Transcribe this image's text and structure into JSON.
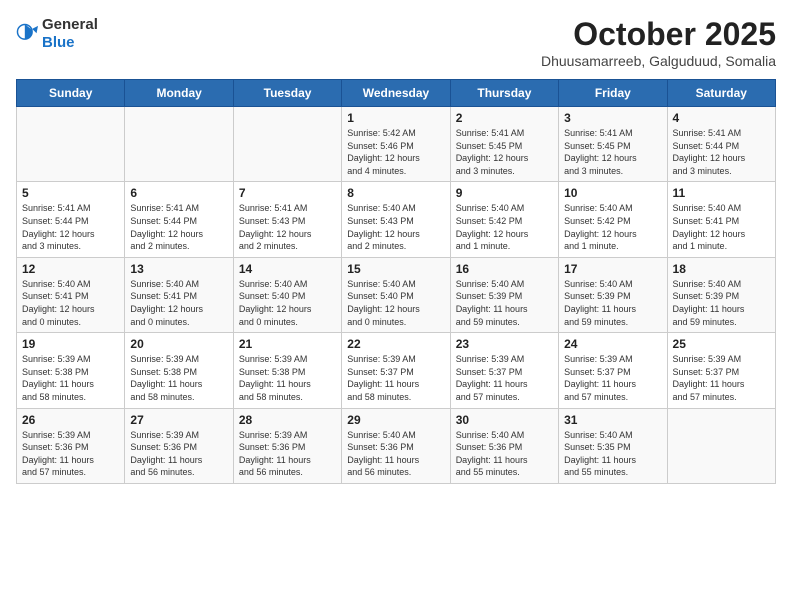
{
  "header": {
    "logo_general": "General",
    "logo_blue": "Blue",
    "month": "October 2025",
    "location": "Dhuusamarreeb, Galguduud, Somalia"
  },
  "weekdays": [
    "Sunday",
    "Monday",
    "Tuesday",
    "Wednesday",
    "Thursday",
    "Friday",
    "Saturday"
  ],
  "weeks": [
    [
      {
        "day": "",
        "info": ""
      },
      {
        "day": "",
        "info": ""
      },
      {
        "day": "",
        "info": ""
      },
      {
        "day": "1",
        "info": "Sunrise: 5:42 AM\nSunset: 5:46 PM\nDaylight: 12 hours\nand 4 minutes."
      },
      {
        "day": "2",
        "info": "Sunrise: 5:41 AM\nSunset: 5:45 PM\nDaylight: 12 hours\nand 3 minutes."
      },
      {
        "day": "3",
        "info": "Sunrise: 5:41 AM\nSunset: 5:45 PM\nDaylight: 12 hours\nand 3 minutes."
      },
      {
        "day": "4",
        "info": "Sunrise: 5:41 AM\nSunset: 5:44 PM\nDaylight: 12 hours\nand 3 minutes."
      }
    ],
    [
      {
        "day": "5",
        "info": "Sunrise: 5:41 AM\nSunset: 5:44 PM\nDaylight: 12 hours\nand 3 minutes."
      },
      {
        "day": "6",
        "info": "Sunrise: 5:41 AM\nSunset: 5:44 PM\nDaylight: 12 hours\nand 2 minutes."
      },
      {
        "day": "7",
        "info": "Sunrise: 5:41 AM\nSunset: 5:43 PM\nDaylight: 12 hours\nand 2 minutes."
      },
      {
        "day": "8",
        "info": "Sunrise: 5:40 AM\nSunset: 5:43 PM\nDaylight: 12 hours\nand 2 minutes."
      },
      {
        "day": "9",
        "info": "Sunrise: 5:40 AM\nSunset: 5:42 PM\nDaylight: 12 hours\nand 1 minute."
      },
      {
        "day": "10",
        "info": "Sunrise: 5:40 AM\nSunset: 5:42 PM\nDaylight: 12 hours\nand 1 minute."
      },
      {
        "day": "11",
        "info": "Sunrise: 5:40 AM\nSunset: 5:41 PM\nDaylight: 12 hours\nand 1 minute."
      }
    ],
    [
      {
        "day": "12",
        "info": "Sunrise: 5:40 AM\nSunset: 5:41 PM\nDaylight: 12 hours\nand 0 minutes."
      },
      {
        "day": "13",
        "info": "Sunrise: 5:40 AM\nSunset: 5:41 PM\nDaylight: 12 hours\nand 0 minutes."
      },
      {
        "day": "14",
        "info": "Sunrise: 5:40 AM\nSunset: 5:40 PM\nDaylight: 12 hours\nand 0 minutes."
      },
      {
        "day": "15",
        "info": "Sunrise: 5:40 AM\nSunset: 5:40 PM\nDaylight: 12 hours\nand 0 minutes."
      },
      {
        "day": "16",
        "info": "Sunrise: 5:40 AM\nSunset: 5:39 PM\nDaylight: 11 hours\nand 59 minutes."
      },
      {
        "day": "17",
        "info": "Sunrise: 5:40 AM\nSunset: 5:39 PM\nDaylight: 11 hours\nand 59 minutes."
      },
      {
        "day": "18",
        "info": "Sunrise: 5:40 AM\nSunset: 5:39 PM\nDaylight: 11 hours\nand 59 minutes."
      }
    ],
    [
      {
        "day": "19",
        "info": "Sunrise: 5:39 AM\nSunset: 5:38 PM\nDaylight: 11 hours\nand 58 minutes."
      },
      {
        "day": "20",
        "info": "Sunrise: 5:39 AM\nSunset: 5:38 PM\nDaylight: 11 hours\nand 58 minutes."
      },
      {
        "day": "21",
        "info": "Sunrise: 5:39 AM\nSunset: 5:38 PM\nDaylight: 11 hours\nand 58 minutes."
      },
      {
        "day": "22",
        "info": "Sunrise: 5:39 AM\nSunset: 5:37 PM\nDaylight: 11 hours\nand 58 minutes."
      },
      {
        "day": "23",
        "info": "Sunrise: 5:39 AM\nSunset: 5:37 PM\nDaylight: 11 hours\nand 57 minutes."
      },
      {
        "day": "24",
        "info": "Sunrise: 5:39 AM\nSunset: 5:37 PM\nDaylight: 11 hours\nand 57 minutes."
      },
      {
        "day": "25",
        "info": "Sunrise: 5:39 AM\nSunset: 5:37 PM\nDaylight: 11 hours\nand 57 minutes."
      }
    ],
    [
      {
        "day": "26",
        "info": "Sunrise: 5:39 AM\nSunset: 5:36 PM\nDaylight: 11 hours\nand 57 minutes."
      },
      {
        "day": "27",
        "info": "Sunrise: 5:39 AM\nSunset: 5:36 PM\nDaylight: 11 hours\nand 56 minutes."
      },
      {
        "day": "28",
        "info": "Sunrise: 5:39 AM\nSunset: 5:36 PM\nDaylight: 11 hours\nand 56 minutes."
      },
      {
        "day": "29",
        "info": "Sunrise: 5:40 AM\nSunset: 5:36 PM\nDaylight: 11 hours\nand 56 minutes."
      },
      {
        "day": "30",
        "info": "Sunrise: 5:40 AM\nSunset: 5:36 PM\nDaylight: 11 hours\nand 55 minutes."
      },
      {
        "day": "31",
        "info": "Sunrise: 5:40 AM\nSunset: 5:35 PM\nDaylight: 11 hours\nand 55 minutes."
      },
      {
        "day": "",
        "info": ""
      }
    ]
  ]
}
